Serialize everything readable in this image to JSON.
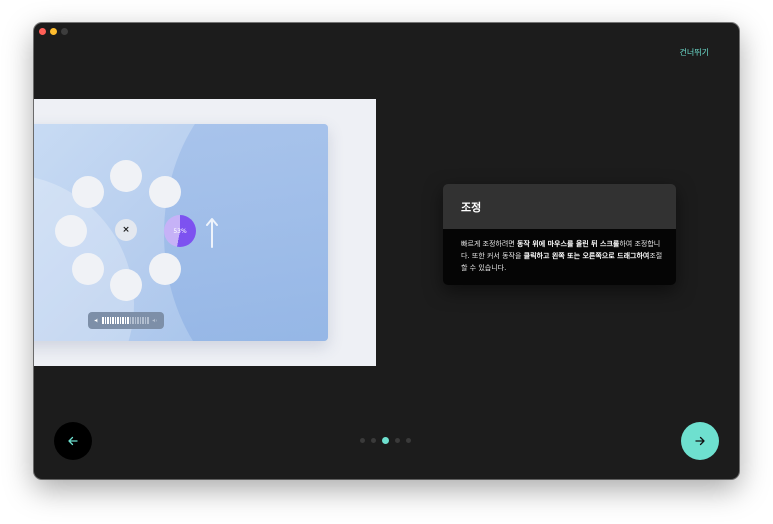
{
  "header": {
    "skip_label": "건너뛰기"
  },
  "illustration": {
    "percent_label": "53%",
    "center_symbol": "×",
    "colors": {
      "percent_fill": "#7d52f0",
      "screen_bg": "#b6cdee"
    }
  },
  "tooltip": {
    "title": "조정",
    "body_segments": [
      {
        "text": "빠르게 조정하려면 ",
        "bold": false
      },
      {
        "text": "동작 위에 마우스를 올린 뒤 스크롤",
        "bold": true
      },
      {
        "text": "하여 조정합니다. 또한 커서 동작을 ",
        "bold": false
      },
      {
        "text": "클릭하고 왼쪽 또는 오른쪽으로 드래그하여",
        "bold": true
      },
      {
        "text": "조절할 수 있습니다.",
        "bold": false
      }
    ]
  },
  "navigation": {
    "back_icon": "arrow-left-icon",
    "next_icon": "arrow-right-icon",
    "page_count": 5,
    "current_page": 3
  },
  "colors": {
    "accent": "#6ee0cf",
    "window_bg": "#1c1c1c"
  }
}
